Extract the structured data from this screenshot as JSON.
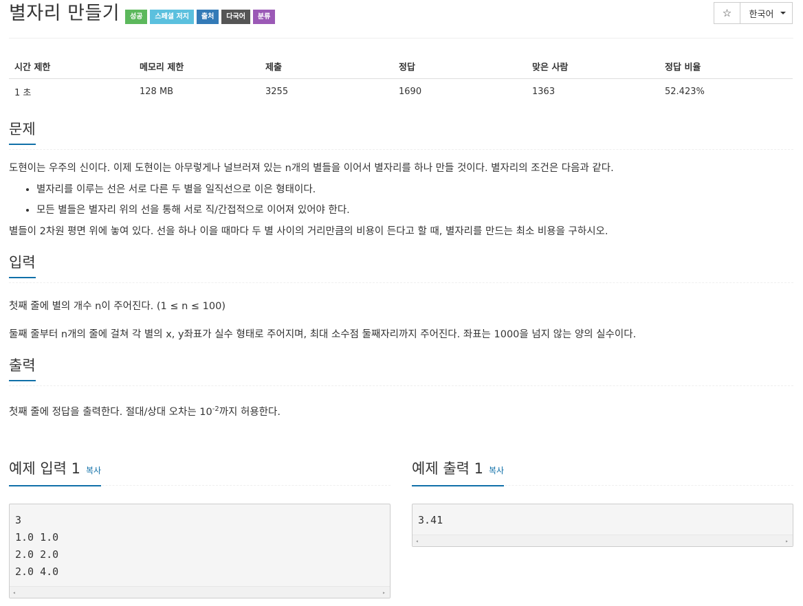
{
  "problem": {
    "title": "별자리 만들기",
    "labels": [
      {
        "text": "성공",
        "color": "#5cb85c"
      },
      {
        "text": "스페셜 저지",
        "color": "#5bc0de"
      },
      {
        "text": "출처",
        "color": "#337ab7"
      },
      {
        "text": "다국어",
        "color": "#555555"
      },
      {
        "text": "분류",
        "color": "#9b59b6"
      }
    ]
  },
  "actions": {
    "star_icon": "star-icon",
    "star_glyph": "☆",
    "language": "한국어"
  },
  "info": {
    "headers": [
      "시간 제한",
      "메모리 제한",
      "제출",
      "정답",
      "맞은 사람",
      "정답 비율"
    ],
    "values": [
      "1 초",
      "128 MB",
      "3255",
      "1690",
      "1363",
      "52.423%"
    ]
  },
  "sections": {
    "problem": {
      "title": "문제",
      "intro": "도현이는 우주의 신이다. 이제 도현이는 아무렇게나 널브러져 있는 n개의 별들을 이어서 별자리를 하나 만들 것이다. 별자리의 조건은 다음과 같다.",
      "bullets": [
        "별자리를 이루는 선은 서로 다른 두 별을 일직선으로 이은 형태이다.",
        "모든 별들은 별자리 위의 선을 통해 서로 직/간접적으로 이어져 있어야 한다."
      ],
      "outro": "별들이 2차원 평면 위에 놓여 있다. 선을 하나 이을 때마다 두 별 사이의 거리만큼의 비용이 든다고 할 때, 별자리를 만드는 최소 비용을 구하시오."
    },
    "input": {
      "title": "입력",
      "line1": "첫째 줄에 별의 개수 n이 주어진다. (1 ≤ n ≤ 100)",
      "line2": "둘째 줄부터 n개의 줄에 걸쳐 각 별의 x, y좌표가 실수 형태로 주어지며, 최대 소수점 둘째자리까지 주어진다. 좌표는 1000을 넘지 않는 양의 실수이다."
    },
    "output": {
      "title": "출력",
      "text_before": "첫째 줄에 정답을 출력한다. 절대/상대 오차는 10",
      "sup": "-2",
      "text_after": "까지 허용한다."
    }
  },
  "samples": {
    "input": {
      "title": "예제 입력 1",
      "copy": "복사",
      "lines": [
        "3",
        "1.0 1.0",
        "2.0 2.0",
        "2.0 4.0"
      ]
    },
    "output": {
      "title": "예제 출력 1",
      "copy": "복사",
      "lines": [
        "3.41"
      ]
    }
  },
  "scroll": {
    "left": "◂",
    "right": "▸"
  }
}
